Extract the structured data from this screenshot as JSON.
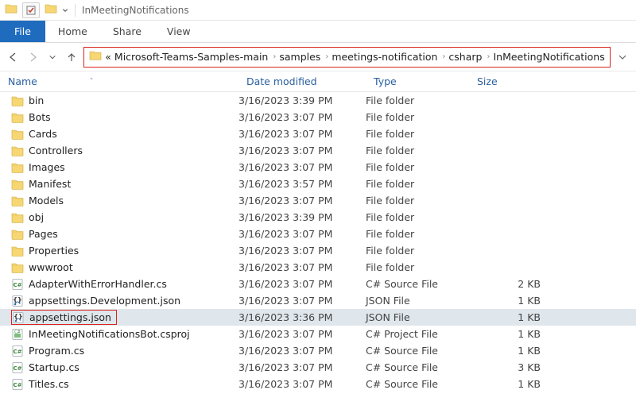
{
  "window": {
    "title": "InMeetingNotifications"
  },
  "ribbon": {
    "file": "File",
    "home": "Home",
    "share": "Share",
    "view": "View"
  },
  "breadcrumbs": {
    "overflow": "«",
    "items": [
      "Microsoft-Teams-Samples-main",
      "samples",
      "meetings-notification",
      "csharp",
      "InMeetingNotifications"
    ]
  },
  "columns": {
    "name": "Name",
    "date": "Date modified",
    "type": "Type",
    "size": "Size"
  },
  "files": [
    {
      "icon": "folder",
      "name": "bin",
      "date": "3/16/2023 3:39 PM",
      "type": "File folder",
      "size": ""
    },
    {
      "icon": "folder",
      "name": "Bots",
      "date": "3/16/2023 3:07 PM",
      "type": "File folder",
      "size": ""
    },
    {
      "icon": "folder",
      "name": "Cards",
      "date": "3/16/2023 3:07 PM",
      "type": "File folder",
      "size": ""
    },
    {
      "icon": "folder",
      "name": "Controllers",
      "date": "3/16/2023 3:07 PM",
      "type": "File folder",
      "size": ""
    },
    {
      "icon": "folder",
      "name": "Images",
      "date": "3/16/2023 3:07 PM",
      "type": "File folder",
      "size": ""
    },
    {
      "icon": "folder",
      "name": "Manifest",
      "date": "3/16/2023 3:57 PM",
      "type": "File folder",
      "size": ""
    },
    {
      "icon": "folder",
      "name": "Models",
      "date": "3/16/2023 3:07 PM",
      "type": "File folder",
      "size": ""
    },
    {
      "icon": "folder",
      "name": "obj",
      "date": "3/16/2023 3:39 PM",
      "type": "File folder",
      "size": ""
    },
    {
      "icon": "folder",
      "name": "Pages",
      "date": "3/16/2023 3:07 PM",
      "type": "File folder",
      "size": ""
    },
    {
      "icon": "folder",
      "name": "Properties",
      "date": "3/16/2023 3:07 PM",
      "type": "File folder",
      "size": ""
    },
    {
      "icon": "folder",
      "name": "wwwroot",
      "date": "3/16/2023 3:07 PM",
      "type": "File folder",
      "size": ""
    },
    {
      "icon": "cs",
      "name": "AdapterWithErrorHandler.cs",
      "date": "3/16/2023 3:07 PM",
      "type": "C# Source File",
      "size": "2 KB"
    },
    {
      "icon": "json",
      "name": "appsettings.Development.json",
      "date": "3/16/2023 3:07 PM",
      "type": "JSON File",
      "size": "1 KB"
    },
    {
      "icon": "json",
      "name": "appsettings.json",
      "date": "3/16/2023 3:36 PM",
      "type": "JSON File",
      "size": "1 KB",
      "selected": true,
      "highlighted": true
    },
    {
      "icon": "csproj",
      "name": "InMeetingNotificationsBot.csproj",
      "date": "3/16/2023 3:07 PM",
      "type": "C# Project File",
      "size": "1 KB"
    },
    {
      "icon": "cs",
      "name": "Program.cs",
      "date": "3/16/2023 3:07 PM",
      "type": "C# Source File",
      "size": "1 KB"
    },
    {
      "icon": "cs",
      "name": "Startup.cs",
      "date": "3/16/2023 3:07 PM",
      "type": "C# Source File",
      "size": "3 KB"
    },
    {
      "icon": "cs",
      "name": "Titles.cs",
      "date": "3/16/2023 3:07 PM",
      "type": "C# Source File",
      "size": "1 KB"
    }
  ]
}
